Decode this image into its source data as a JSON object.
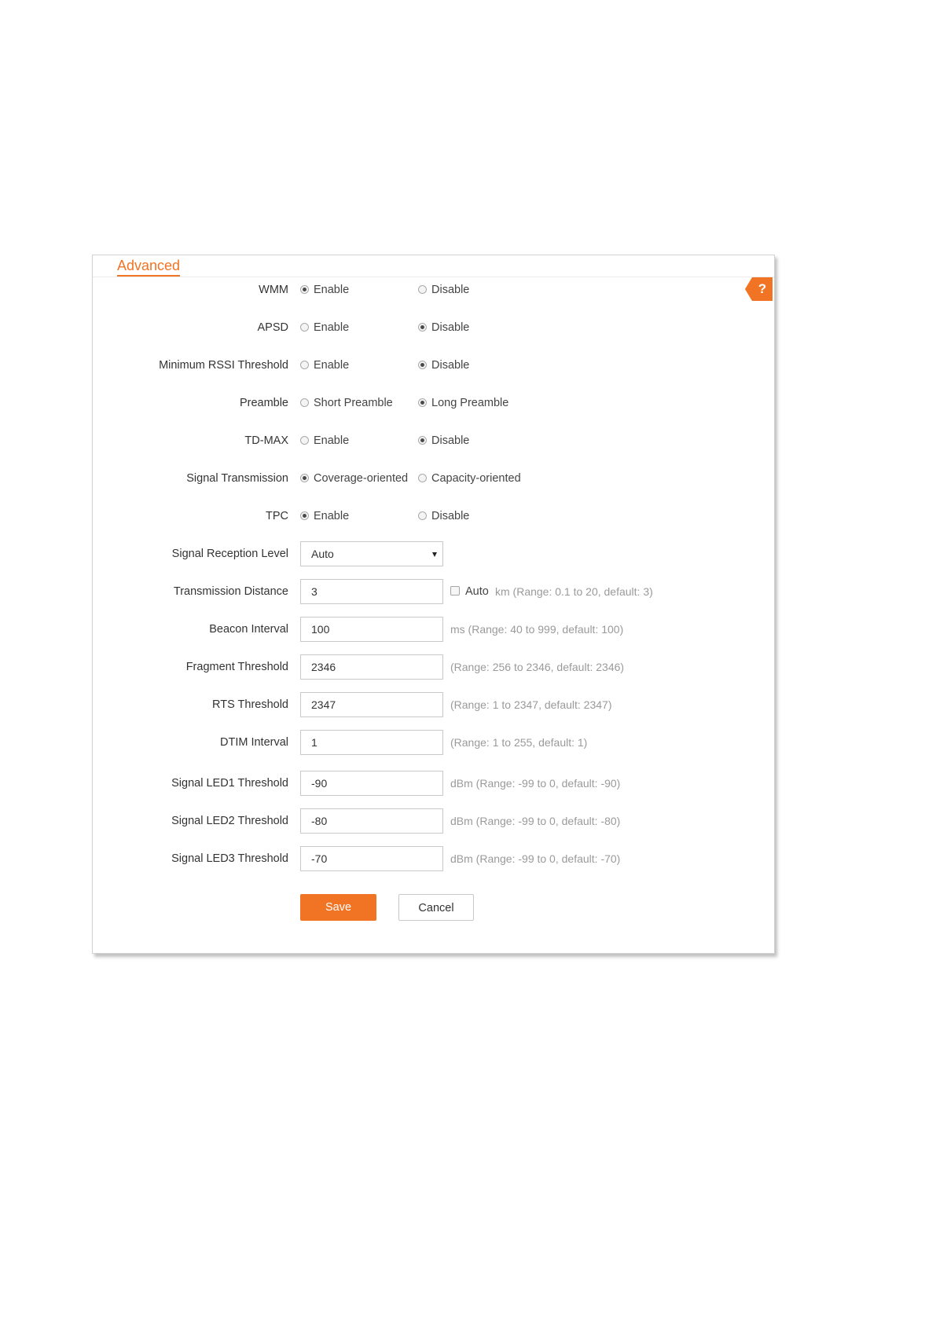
{
  "panel": {
    "title": "Advanced",
    "help_label": "?"
  },
  "radios": [
    {
      "label": "WMM",
      "option_a": "Enable",
      "option_b": "Disable",
      "selected": "a"
    },
    {
      "label": "APSD",
      "option_a": "Enable",
      "option_b": "Disable",
      "selected": "b"
    },
    {
      "label": "Minimum RSSI Threshold",
      "option_a": "Enable",
      "option_b": "Disable",
      "selected": "b"
    },
    {
      "label": "Preamble",
      "option_a": "Short Preamble",
      "option_b": "Long Preamble",
      "selected": "b"
    },
    {
      "label": "TD-MAX",
      "option_a": "Enable",
      "option_b": "Disable",
      "selected": "b"
    },
    {
      "label": "Signal Transmission",
      "option_a": "Coverage-oriented",
      "option_b": "Capacity-oriented",
      "selected": "a"
    },
    {
      "label": "TPC",
      "option_a": "Enable",
      "option_b": "Disable",
      "selected": "a"
    }
  ],
  "signal_reception": {
    "label": "Signal Reception Level",
    "value": "Auto"
  },
  "transmission_distance": {
    "label": "Transmission Distance",
    "value": "3",
    "auto_label": "Auto",
    "auto_checked": false,
    "hint": "km (Range: 0.1 to 20, default: 3)"
  },
  "fields": [
    {
      "label": "Beacon Interval",
      "value": "100",
      "hint": "ms (Range: 40 to 999, default: 100)"
    },
    {
      "label": "Fragment Threshold",
      "value": "2346",
      "hint": "(Range: 256 to 2346, default: 2346)"
    },
    {
      "label": "RTS Threshold",
      "value": "2347",
      "hint": "(Range: 1 to 2347, default: 2347)"
    },
    {
      "label": "DTIM Interval",
      "value": "1",
      "hint": "(Range: 1 to 255, default: 1)"
    },
    {
      "label": "Signal LED1 Threshold",
      "value": "-90",
      "hint": "dBm (Range: -99 to 0, default: -90)"
    },
    {
      "label": "Signal LED2 Threshold",
      "value": "-80",
      "hint": "dBm (Range: -99 to 0, default: -80)"
    },
    {
      "label": "Signal LED3 Threshold",
      "value": "-70",
      "hint": "dBm (Range: -99 to 0, default: -70)"
    }
  ],
  "buttons": {
    "save": "Save",
    "cancel": "Cancel"
  },
  "colors": {
    "accent": "#f07424"
  }
}
